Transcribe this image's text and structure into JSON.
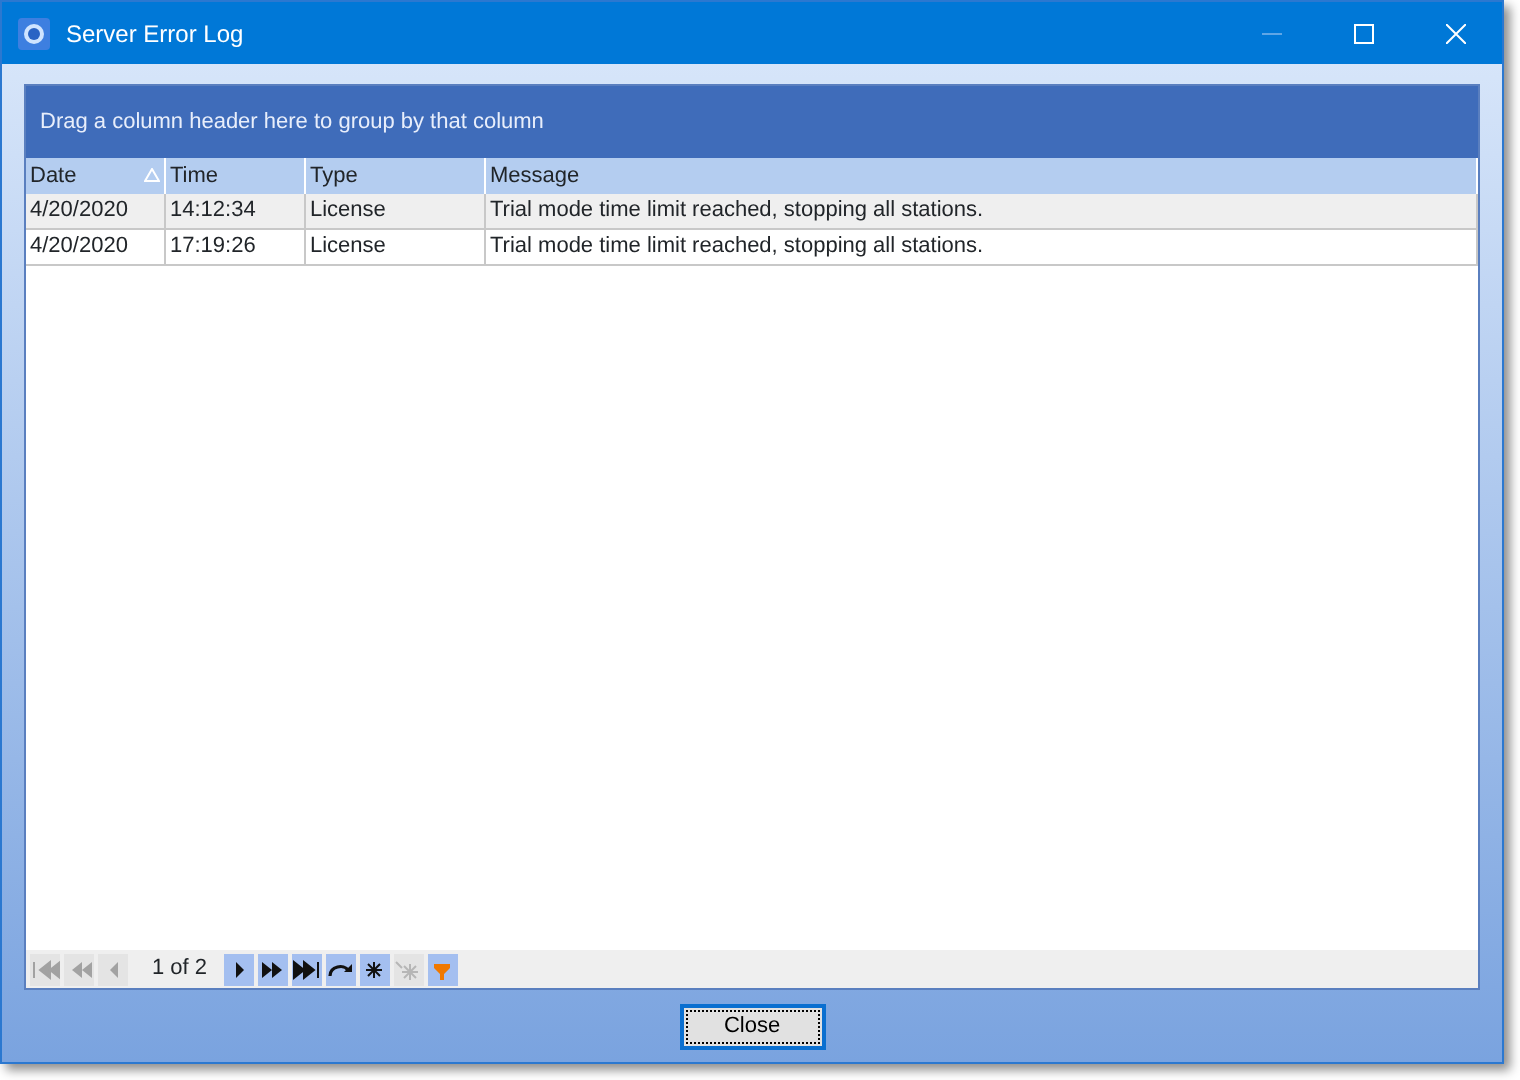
{
  "window": {
    "title": "Server Error Log",
    "controls": [
      {
        "kind": "minimize",
        "disabled": true
      },
      {
        "kind": "maximize",
        "disabled": false
      },
      {
        "kind": "close",
        "disabled": false
      }
    ]
  },
  "group_panel": {
    "text": "Drag a column header here to group by that column"
  },
  "table": {
    "columns": [
      {
        "label": "Date",
        "sorted": true
      },
      {
        "label": "Time",
        "sorted": false
      },
      {
        "label": "Type",
        "sorted": false
      },
      {
        "label": "Message",
        "sorted": false
      }
    ],
    "rows": [
      {
        "selected": true,
        "cells": [
          "4/20/2020",
          "14:12:34",
          "License",
          "Trial mode time limit reached, stopping all stations."
        ]
      },
      {
        "selected": false,
        "cells": [
          "4/20/2020",
          "17:19:26",
          "License",
          "Trial mode time limit reached, stopping all stations."
        ]
      }
    ]
  },
  "navigator": {
    "before": [
      {
        "kind": "first",
        "disabled": true
      },
      {
        "kind": "prev-page",
        "disabled": true
      },
      {
        "kind": "prev",
        "disabled": true
      }
    ],
    "page_text": "1 of 2",
    "after": [
      {
        "kind": "next",
        "disabled": false
      },
      {
        "kind": "next-page",
        "disabled": false
      },
      {
        "kind": "last",
        "disabled": false
      },
      {
        "kind": "refresh",
        "disabled": false
      },
      {
        "kind": "append",
        "disabled": false
      },
      {
        "kind": "insert",
        "disabled": true
      },
      {
        "kind": "filter",
        "disabled": false
      }
    ]
  },
  "buttons": [
    {
      "label": "Close",
      "focused": true
    }
  ]
}
